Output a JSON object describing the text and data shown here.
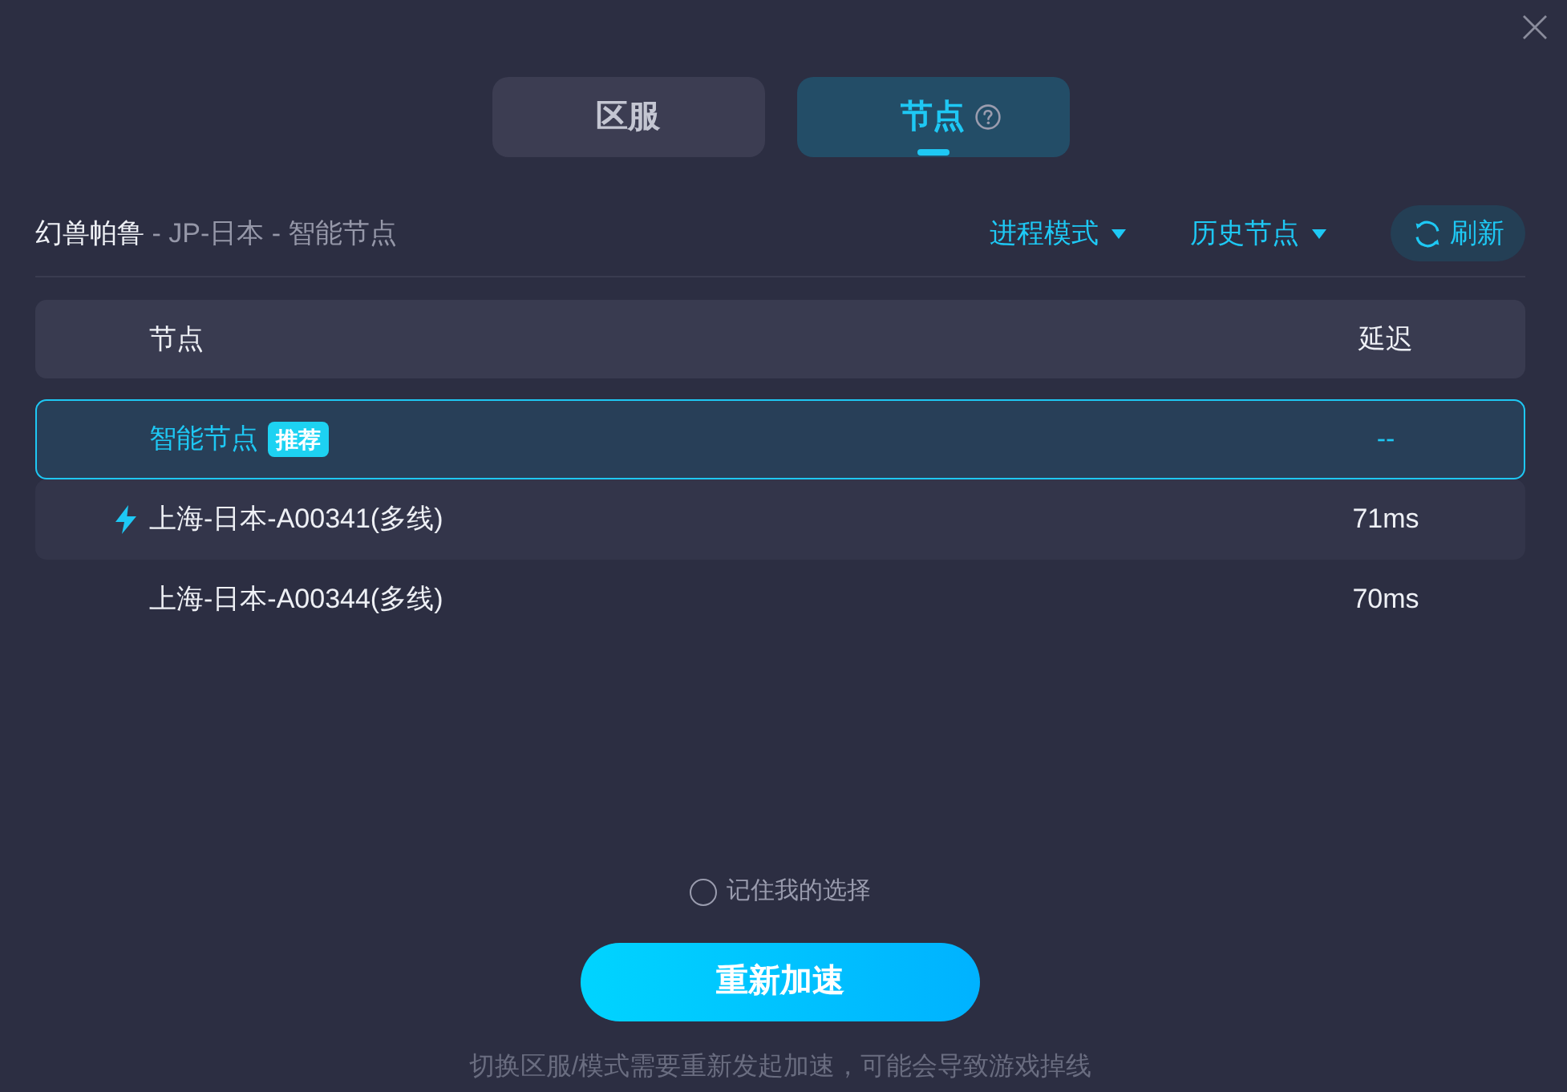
{
  "tabs": [
    {
      "label": "区服",
      "selected": false,
      "help": false
    },
    {
      "label": "节点",
      "selected": true,
      "help": true
    }
  ],
  "breadcrumb": {
    "game": "幻兽帕鲁",
    "path": "- JP-日本 - 智能节点"
  },
  "dropdowns": [
    {
      "label": "进程模式"
    },
    {
      "label": "历史节点"
    }
  ],
  "refresh_button": {
    "label": "刷新"
  },
  "table": {
    "columns": [
      "节点",
      "延迟"
    ],
    "rows": [
      {
        "name": "智能节点",
        "badge": "推荐",
        "latency": "--",
        "selected": true,
        "connected": false
      },
      {
        "name": "上海-日本-A00341(多线)",
        "latency": "71ms",
        "selected": false,
        "connected": true
      },
      {
        "name": "上海-日本-A00344(多线)",
        "latency": "70ms",
        "selected": false,
        "connected": false
      }
    ]
  },
  "remember_choice": {
    "label": "记住我的选择",
    "checked": false
  },
  "primary_button": {
    "label": "重新加速"
  },
  "footer_note": "切换区服/模式需要重新发起加速，可能会导致游戏掉线"
}
